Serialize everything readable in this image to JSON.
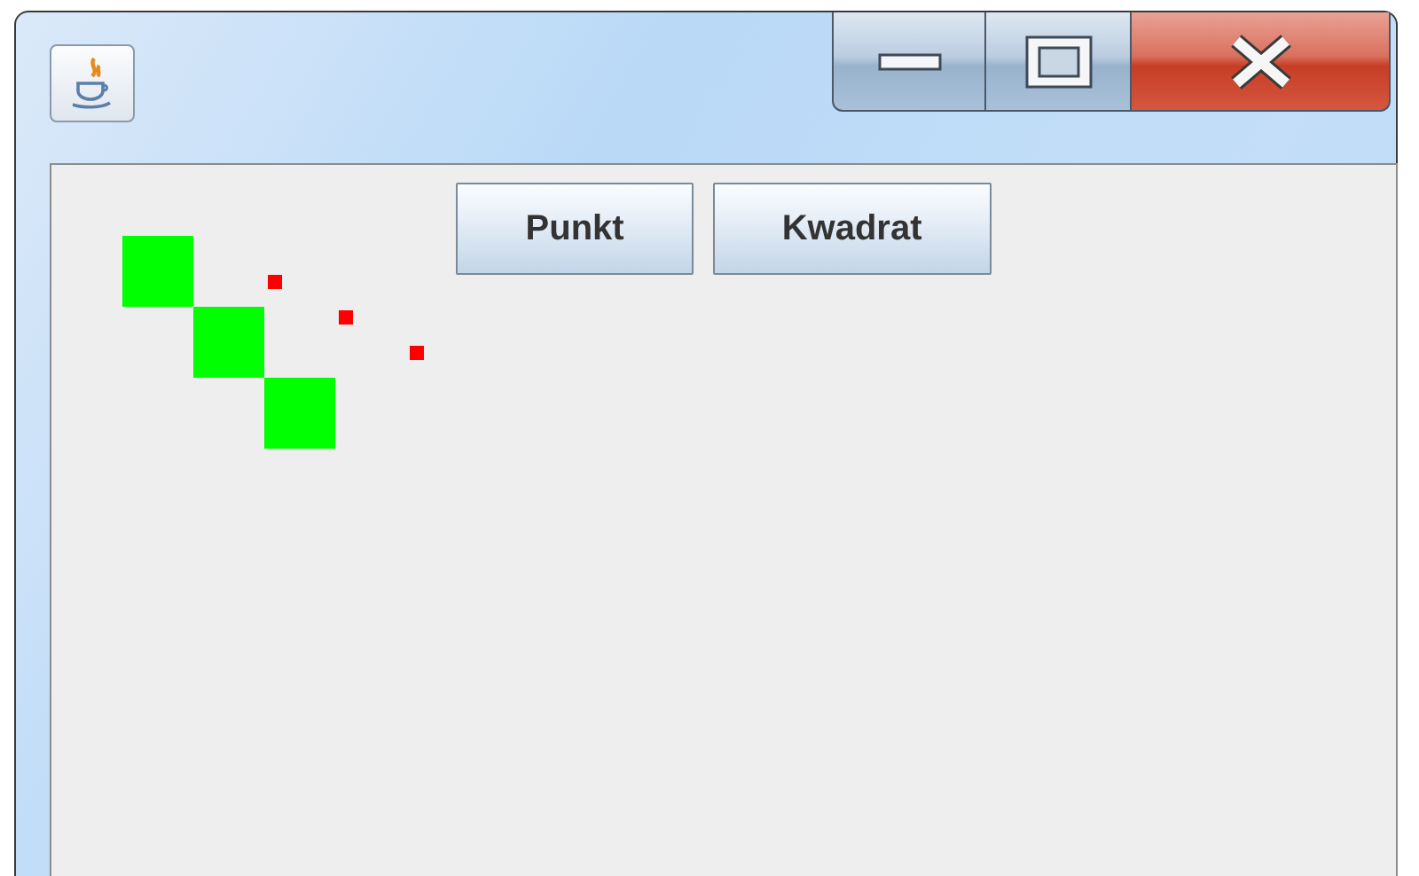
{
  "buttons": [
    "Punkt",
    "Kwadrat"
  ],
  "canvas": {
    "shapes": [
      {
        "kind": "square",
        "color": "#00ff00"
      },
      {
        "kind": "square",
        "color": "#00ff00"
      },
      {
        "kind": "square",
        "color": "#00ff00"
      },
      {
        "kind": "dot",
        "color": "#ff0000"
      },
      {
        "kind": "dot",
        "color": "#ff0000"
      },
      {
        "kind": "dot",
        "color": "#ff0000"
      }
    ]
  }
}
